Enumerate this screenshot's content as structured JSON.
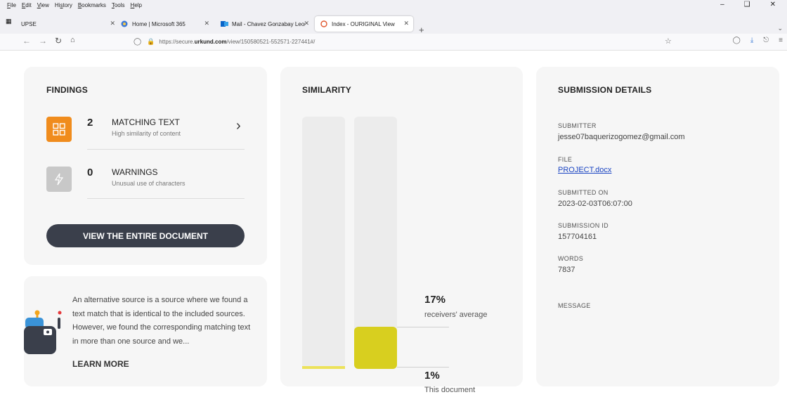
{
  "browser": {
    "menu": [
      "File",
      "Edit",
      "View",
      "History",
      "Bookmarks",
      "Tools",
      "Help"
    ],
    "tabs": [
      {
        "label": "UPSE"
      },
      {
        "label": "Home | Microsoft 365"
      },
      {
        "label": "Mail - Chavez Gonzabay Leona"
      },
      {
        "label": "Index - OURIGINAL View"
      }
    ],
    "url_prefix": "https://secure.",
    "url_domain": "urkund.com",
    "url_path": "/view/150580521-552571-227441#/"
  },
  "findings": {
    "title": "FINDINGS",
    "items": [
      {
        "count": "2",
        "label": "MATCHING TEXT",
        "sub": "High similarity of content",
        "icon": "grid-icon",
        "color": "#f08c1d"
      },
      {
        "count": "0",
        "label": "WARNINGS",
        "sub": "Unusual use of characters",
        "icon": "lightning-icon",
        "color": "#c8c8c8"
      }
    ],
    "button": "VIEW THE ENTIRE DOCUMENT"
  },
  "info": {
    "text": "An alternative source is a source where we found a text match that is identical to the included sources. However, we found the corresponding matching text in more than one source and we...",
    "link": "LEARN MORE"
  },
  "similarity": {
    "title": "SIMILARITY",
    "receivers_average": {
      "value": "17%",
      "label": "receivers' average",
      "level": 0.17,
      "color": "#d8cf1f"
    },
    "this_document": {
      "value": "1%",
      "label": "This document",
      "level": 0.01,
      "color": "#ece25a"
    }
  },
  "submission": {
    "title": "SUBMISSION DETAILS",
    "submitter_label": "SUBMITTER",
    "submitter": "jesse07baquerizogomez@gmail.com",
    "file_label": "FILE",
    "file": "PROJECT.docx",
    "submitted_on_label": "SUBMITTED ON",
    "submitted_on": "2023-02-03T06:07:00",
    "submission_id_label": "SUBMISSION ID",
    "submission_id": "157704161",
    "words_label": "WORDS",
    "words": "7837",
    "message_label": "MESSAGE"
  }
}
